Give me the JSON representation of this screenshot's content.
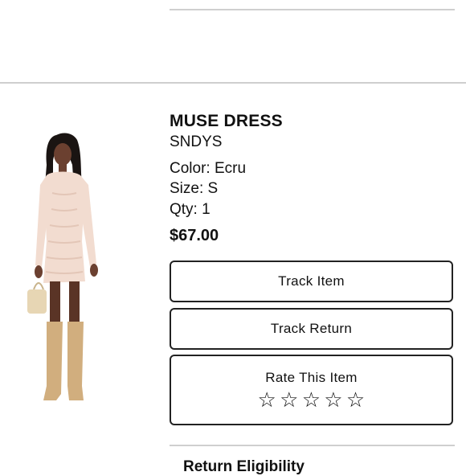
{
  "product": {
    "name": "MUSE DRESS",
    "brand": "SNDYS",
    "color": "Color: Ecru",
    "size": "Size: S",
    "qty": "Qty: 1",
    "price": "$67.00"
  },
  "actions": {
    "track_item": "Track Item",
    "track_return": "Track Return",
    "rate_item": "Rate This Item"
  },
  "rating": {
    "stars_filled": 0,
    "stars_total": 5,
    "star_glyph": "☆"
  },
  "footer": {
    "partial_text": "Return Eligibility"
  }
}
